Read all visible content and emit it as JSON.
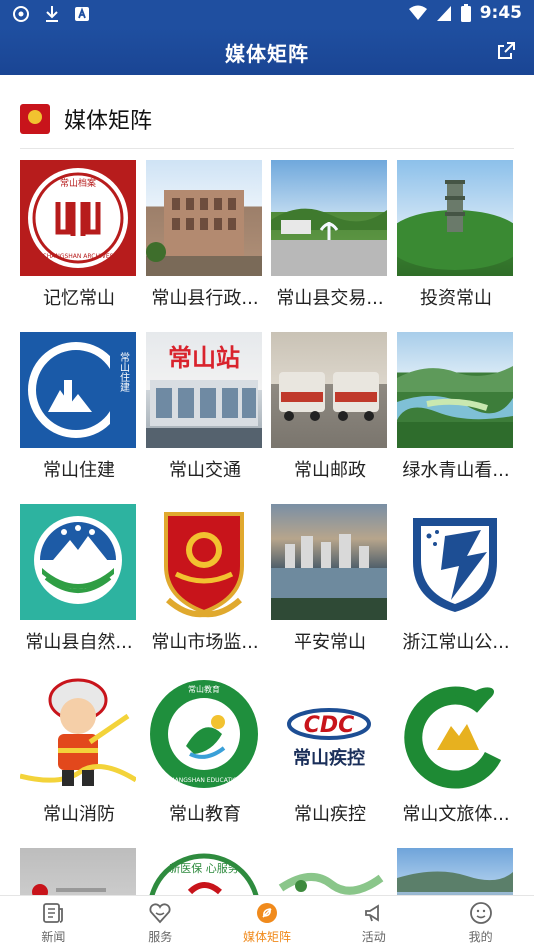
{
  "status": {
    "time": "9:45"
  },
  "appbar": {
    "title": "媒体矩阵",
    "share_icon": "share-icon"
  },
  "section": {
    "title": "媒体矩阵"
  },
  "items": [
    {
      "label": "记忆常山"
    },
    {
      "label": "常山县行政..."
    },
    {
      "label": "常山县交易..."
    },
    {
      "label": "投资常山"
    },
    {
      "label": "常山住建"
    },
    {
      "label": "常山交通"
    },
    {
      "label": "常山邮政"
    },
    {
      "label": "绿水青山看..."
    },
    {
      "label": "常山县自然..."
    },
    {
      "label": "常山市场监..."
    },
    {
      "label": "平安常山"
    },
    {
      "label": "浙江常山公..."
    },
    {
      "label": "常山消防"
    },
    {
      "label": "常山教育"
    },
    {
      "label": "常山疾控"
    },
    {
      "label": "常山文旅体..."
    },
    {
      "label": ""
    },
    {
      "label": ""
    },
    {
      "label": ""
    },
    {
      "label": ""
    }
  ],
  "thumb_text": {
    "archives_top": "常山档案",
    "archives_bottom": "CHANGSHAN ARCHIVES",
    "station": "常山站",
    "zhujian": "常山住建",
    "edu_top": "常山教育",
    "edu_bottom": "CHANGSHAN EDUCATION",
    "cdc": "CDC",
    "cdc_cn": "常山疾控",
    "slogan": "新医保 心服务"
  },
  "tabs": [
    {
      "label": "新闻",
      "icon": "news-icon",
      "active": false
    },
    {
      "label": "服务",
      "icon": "service-icon",
      "active": false
    },
    {
      "label": "媒体矩阵",
      "icon": "media-matrix-icon",
      "active": true
    },
    {
      "label": "活动",
      "icon": "activity-icon",
      "active": false
    },
    {
      "label": "我的",
      "icon": "profile-icon",
      "active": false
    }
  ],
  "colors": {
    "primary": "#1f4fa0",
    "active_tab": "#f08a1c"
  }
}
